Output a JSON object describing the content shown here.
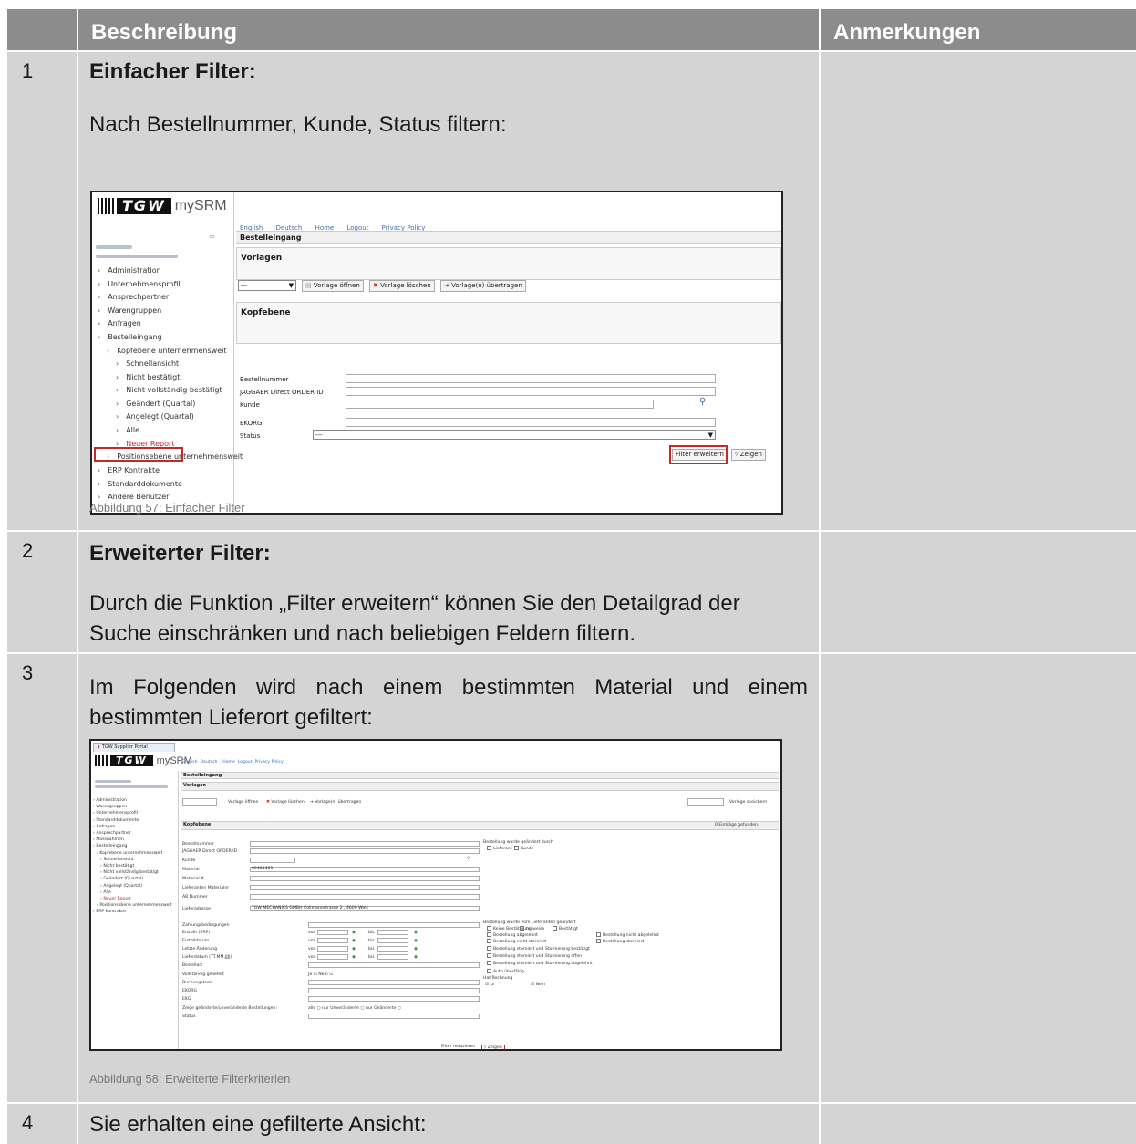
{
  "table": {
    "header": {
      "col_desc": "Beschreibung",
      "col_notes": "Anmerkungen"
    },
    "rows": [
      {
        "num": "1",
        "heading": "Einfacher Filter:",
        "text": "Nach Bestellnummer, Kunde, Status filtern:",
        "caption": "Abbildung 57: Einfacher Filter"
      },
      {
        "num": "2",
        "heading": "Erweiterter Filter:",
        "text": "Durch die Funktion „Filter erweitern“ können Sie den Detailgrad der Suche einschränken und nach beliebigen Feldern filtern."
      },
      {
        "num": "3",
        "text": "Im Folgenden wird nach einem bestimmten Material und einem bestimmten Lieferort gefiltert:",
        "caption": "Abbildung 58: Erweiterte Filterkriterien"
      },
      {
        "num": "4",
        "text": "Sie erhalten eine gefilterte Ansicht:"
      }
    ]
  },
  "shot1": {
    "logo_text": "TGW",
    "logo_suffix": "mySRM",
    "top_links": [
      "English",
      "Deutsch",
      "Home",
      "Logout",
      "Privacy Policy"
    ],
    "page_title": "Bestelleingang",
    "vorlagen_title": "Vorlagen",
    "vorlage_select": "---",
    "btn_open": "Vorlage öffnen",
    "btn_delete": "Vorlage löschen",
    "btn_transfer": "Vorlage(n) übertragen",
    "kopfebene_title": "Kopfebene",
    "fields": {
      "bestellnummer": "Bestellnummer",
      "jaggaer": "JAGGAER Direct ORDER ID",
      "kunde": "Kunde",
      "ekorg": "EKORG",
      "status": "Status",
      "status_value": "---"
    },
    "btn_filter_extend": "Filter erweitern",
    "btn_show": "Zeigen",
    "nav": [
      "Administration",
      "Unternehmensprofil",
      "Ansprechpartner",
      "Warengruppen",
      "Anfragen",
      "Bestelleingang",
      "Kopfebene unternehmensweit",
      "Schnellansicht",
      "Nicht bestätigt",
      "Nicht vollständig bestätigt",
      "Geändert (Quartal)",
      "Angelegt (Quartal)",
      "Alle",
      "Neuer Report",
      "Positionsebene unternehmensweit",
      "ERP Kontrakte",
      "Standarddokumente",
      "Andere Benutzer"
    ]
  },
  "shot2": {
    "tab_title": "TGW Supplier Portal",
    "logo_text": "TGW",
    "logo_suffix": "mySRM",
    "top_links": [
      "English",
      "Deutsch",
      "Home",
      "Logout",
      "Privacy Policy"
    ],
    "page_title": "Bestelleingang",
    "vorlagen_title": "Vorlagen",
    "vorlage_select": "---",
    "btn_open": "Vorlage öffnen",
    "btn_delete": "Vorlage löschen",
    "btn_transfer": "Vorlage(n) übertragen",
    "btn_save": "Vorlage speichern",
    "kopfebene_title": "Kopfebene",
    "entries_found": "0 Einträge gefunden.",
    "left_fields": [
      "Bestellnummer",
      "JAGGAER Direct ORDER ID",
      "Kunde",
      "Material",
      "Material #",
      "Lieferanten Materialnr",
      "AB Nummer",
      "Lieferadresse"
    ],
    "material_value": "00461401",
    "address_value": "TGW MECHANICS GMBH Collmannstrasse 2 , 4600 Wels",
    "lower_fields": [
      "Zahlungsbedingungen",
      "Erstellt (ERP)",
      "Erstelldatum",
      "Letzte Änderung",
      "Lieferdatum (TT.MM.JJJJ)",
      "Bestellart",
      "Vollständig geliefert",
      "Buchungskreis",
      "EKORG",
      "EKG",
      "Zeige geänderte/unveränderte Bestellungen:",
      "Status"
    ],
    "right_group1_title": "Bestellung wurde geändert durch",
    "right_group1": [
      "Lieferant",
      "Kunde"
    ],
    "right_group2_title": "Bestellung wurde vom Lieferanten geändert",
    "right_group2": [
      "Keine Bestätigung",
      "teilweise",
      "Bestätigt",
      "Bestellung abgelehnt",
      "Bestellung nicht abgelehnt",
      "Bestellung nicht storniert",
      "Bestellung storniert",
      "Bestellung storniert und Stornierung bestätigt",
      "Bestellung storniert und Stornierung offen",
      "Bestellung storniert und Stornierung abgelehnt",
      "Auto überfällig"
    ],
    "invoice_title": "Hat Rechnung",
    "invoice_opts": [
      "Ja",
      "Nein"
    ],
    "von": "von",
    "bis": "bis",
    "ja_nein": "Ja",
    "nein": "Nein",
    "show_opts": "alle ○ nur Unveränderte ○ nur Geänderte ○",
    "btn_reduce": "Filter reduzieren",
    "btn_show": "Zeigen",
    "nav": [
      "Administration",
      "Warengruppen",
      "Unternehmensprofil",
      "Standarddokumente",
      "Anfragen",
      "Ansprechpartner",
      "Massnahmen",
      "Bestelleingang",
      "Kopfebene unternehmensweit",
      "Schnellansicht",
      "Nicht bestätigt",
      "Nicht vollständig bestätigt",
      "Geändert (Quartal)",
      "Angelegt (Quartal)",
      "Alle",
      "Neuer Report",
      "Positionsebene unternehmensweit",
      "ERP Kontrakte"
    ]
  }
}
